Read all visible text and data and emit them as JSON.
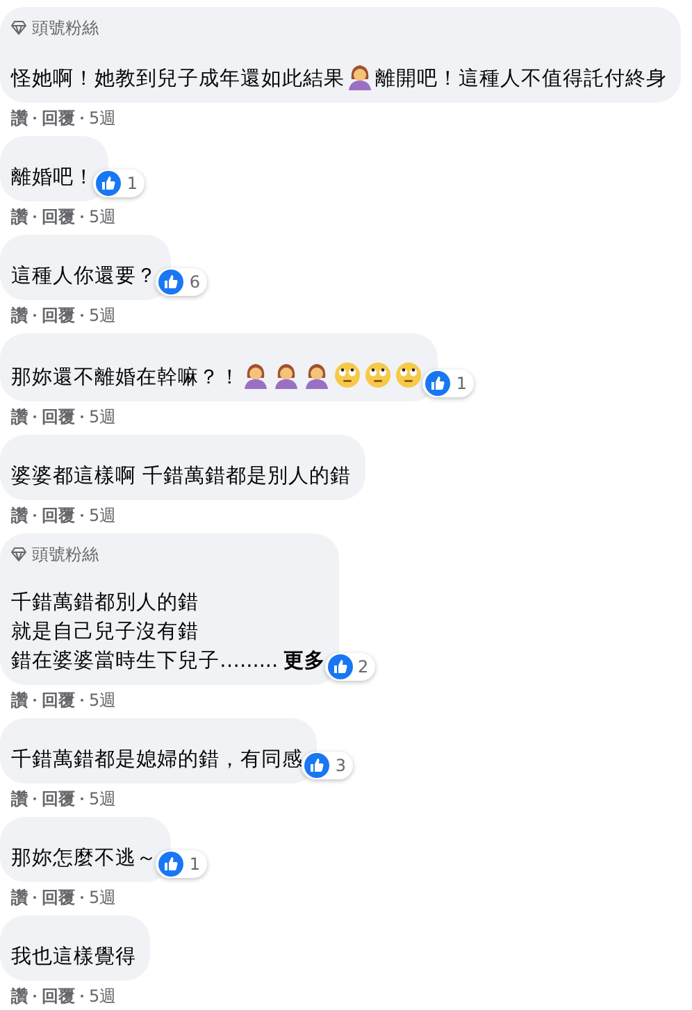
{
  "comments": [
    {
      "badge": "頭號粉絲",
      "body": [
        {
          "kind": "text",
          "text": "怪她啊！她教到兒子成年還如此結果"
        },
        {
          "kind": "woman"
        },
        {
          "kind": "text",
          "text": "離開吧！這種人不值得託付終身"
        }
      ],
      "actions": [
        "讚",
        "回覆"
      ],
      "time": "5週"
    },
    {
      "body": [
        {
          "kind": "text",
          "text": "離婚吧！"
        }
      ],
      "likes": "1",
      "actions": [
        "讚",
        "回覆"
      ],
      "time": "5週"
    },
    {
      "body": [
        {
          "kind": "text",
          "text": "這種人你還要？"
        }
      ],
      "likes": "6",
      "actions": [
        "讚",
        "回覆"
      ],
      "time": "5週"
    },
    {
      "body": [
        {
          "kind": "text",
          "text": "那妳還不離婚在幹嘛？！"
        },
        {
          "kind": "woman"
        },
        {
          "kind": "woman"
        },
        {
          "kind": "woman"
        },
        {
          "kind": "eyeroll"
        },
        {
          "kind": "eyeroll"
        },
        {
          "kind": "eyeroll"
        }
      ],
      "likes": "1",
      "actions": [
        "讚",
        "回覆"
      ],
      "time": "5週"
    },
    {
      "body": [
        {
          "kind": "text",
          "text": "婆婆都這樣啊 千錯萬錯都是別人的錯"
        }
      ],
      "actions": [
        "讚",
        "回覆"
      ],
      "time": "5週"
    },
    {
      "badge": "頭號粉絲",
      "body": [
        {
          "kind": "text",
          "text": "千錯萬錯都別人的錯"
        },
        {
          "kind": "break"
        },
        {
          "kind": "text",
          "text": "就是自己兒子沒有錯"
        },
        {
          "kind": "break"
        },
        {
          "kind": "text",
          "text": "錯在婆婆當時生下兒子…......"
        },
        {
          "kind": "link",
          "text": "更多"
        }
      ],
      "likes": "2",
      "actions": [
        "讚",
        "回覆"
      ],
      "time": "5週"
    },
    {
      "body": [
        {
          "kind": "text",
          "text": "千錯萬錯都是媳婦的錯，有同感"
        }
      ],
      "likes": "3",
      "actions": [
        "讚",
        "回覆"
      ],
      "time": "5週"
    },
    {
      "body": [
        {
          "kind": "text",
          "text": "那妳怎麼不逃～"
        }
      ],
      "likes": "1",
      "actions": [
        "讚",
        "回覆"
      ],
      "time": "5週"
    },
    {
      "body": [
        {
          "kind": "text",
          "text": "我也這樣覺得"
        }
      ],
      "actions": [
        "讚",
        "回覆"
      ],
      "time": "5週"
    }
  ]
}
